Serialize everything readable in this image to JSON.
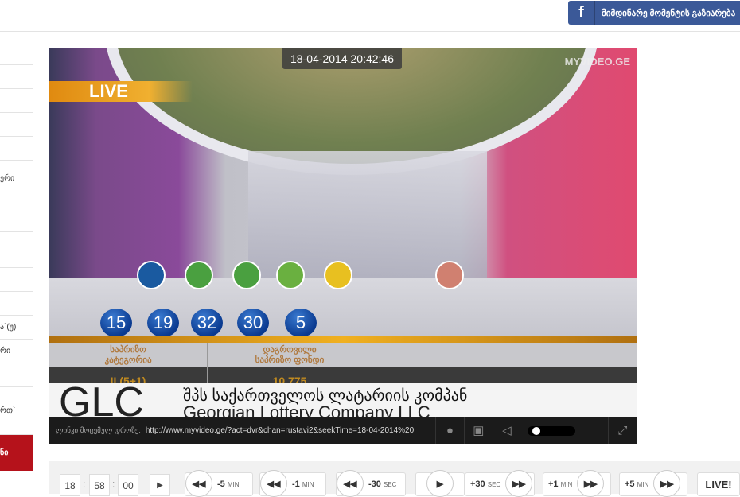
{
  "header": {
    "facebook_button": "მიმდინარე მომენტის გაზიარება",
    "facebook_icon": "f"
  },
  "sidebar": {
    "items": [
      "",
      "",
      "",
      "",
      "",
      "ერი",
      "",
      "",
      "",
      "",
      "ა`(უ)",
      "რი",
      "",
      "რთ`",
      "ნი"
    ],
    "active_color": "#b5121b"
  },
  "video": {
    "timestamp": "18-04-2014  20:42:46",
    "watermark": "MYVIDEO.GE",
    "live_badge": "LIVE",
    "balls": [
      "15",
      "19",
      "32",
      "30",
      "5"
    ],
    "prize_category_label": "საპრიზო კატეგორია",
    "prize_category_value": "II (5+1)",
    "fund_label": "დაგროვილი საპრიზო ფონდი",
    "fund_value": "10 775",
    "ticker_logo": "GLC",
    "ticker_line1": "შპს საქართველოს ლატარიის კომპან",
    "ticker_line2": "Georgian Lottery Company LLC"
  },
  "player_bar": {
    "link_label": "ლინკი მოცემულ დროზე:",
    "link_url": "http://www.myvideo.ge/?act=dvr&chan=rustavi2&seekTime=18-04-2014%20",
    "volume": 0.1
  },
  "controls": {
    "hour": "18",
    "minute": "58",
    "second": "00",
    "back5": "-5",
    "back1": "-1",
    "back30": "-30",
    "fwd30": "+30",
    "fwd1": "+1",
    "fwd5": "+5",
    "min_unit": "MIN",
    "sec_unit": "SEC",
    "live": "LIVE!"
  }
}
